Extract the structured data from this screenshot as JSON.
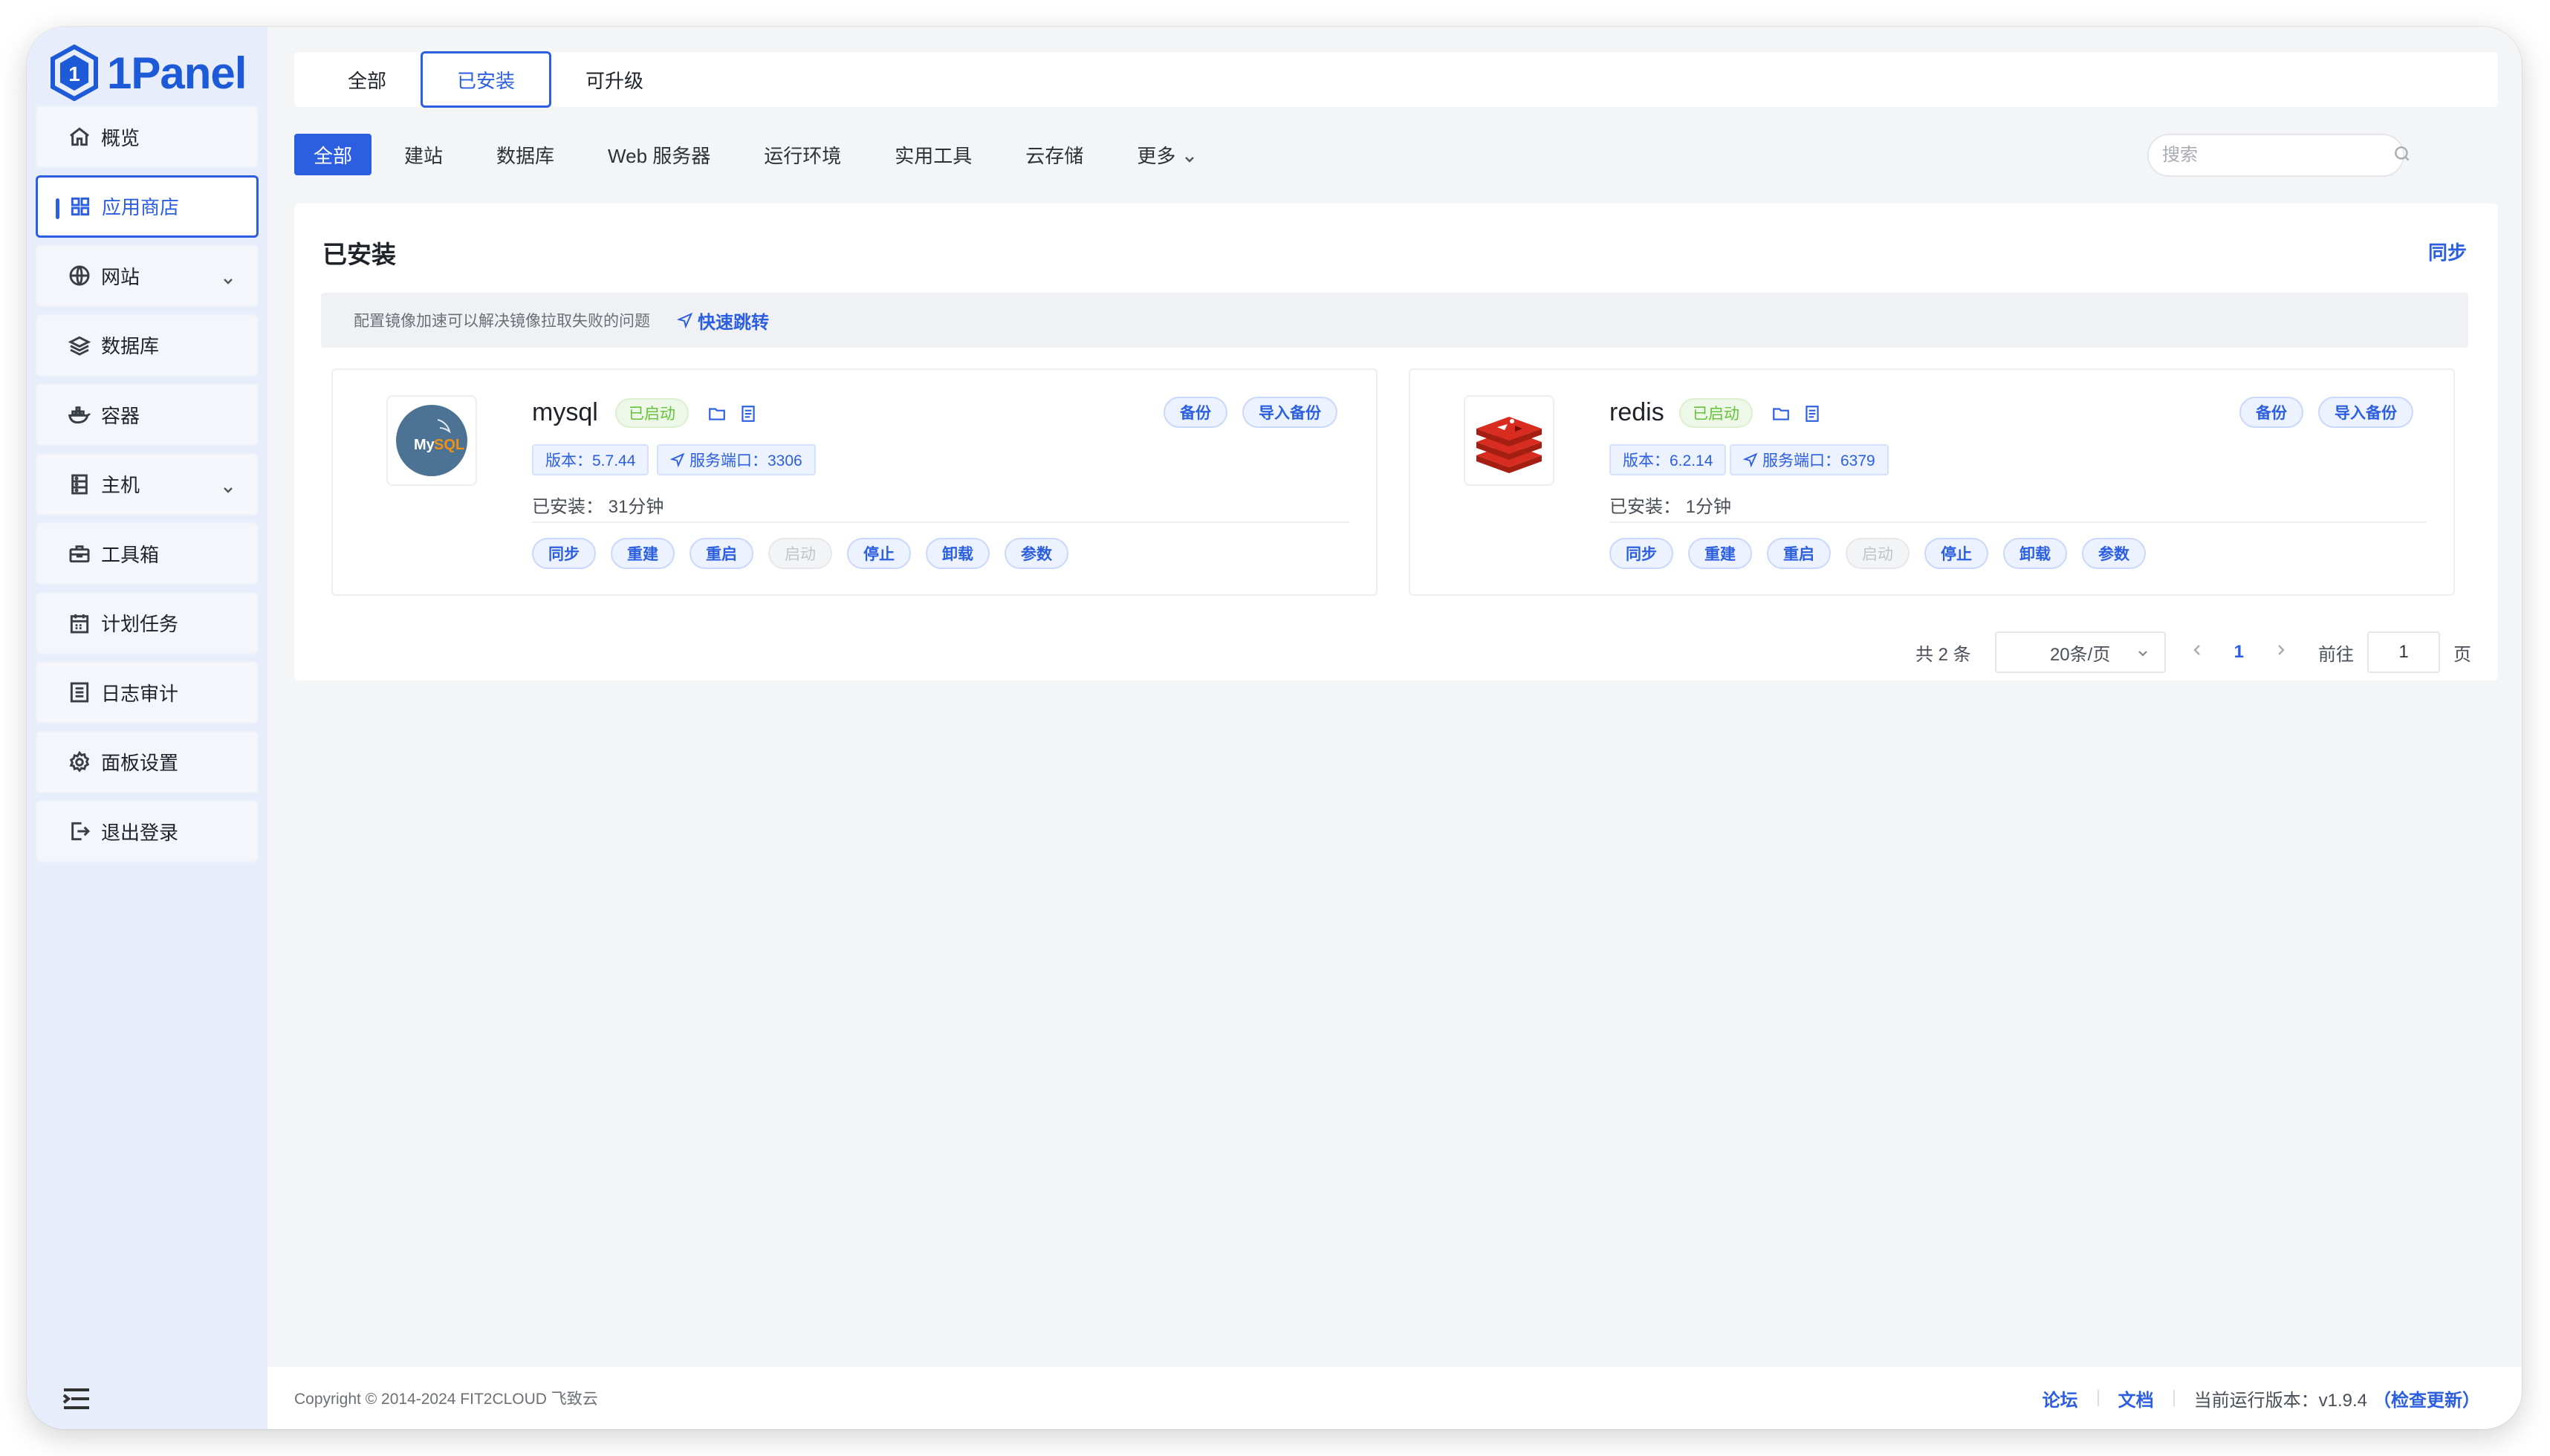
{
  "brand": {
    "name": "1Panel"
  },
  "sidebar": {
    "items": [
      {
        "label": "概览",
        "icon": "home-icon"
      },
      {
        "label": "应用商店",
        "icon": "grid-icon",
        "active": true
      },
      {
        "label": "网站",
        "icon": "globe-icon",
        "expandable": true
      },
      {
        "label": "数据库",
        "icon": "layers-icon"
      },
      {
        "label": "容器",
        "icon": "docker-whale-icon"
      },
      {
        "label": "主机",
        "icon": "server-icon",
        "expandable": true
      },
      {
        "label": "工具箱",
        "icon": "toolbox-icon"
      },
      {
        "label": "计划任务",
        "icon": "calendar-icon"
      },
      {
        "label": "日志审计",
        "icon": "log-icon"
      },
      {
        "label": "面板设置",
        "icon": "gear-icon"
      },
      {
        "label": "退出登录",
        "icon": "logout-icon"
      }
    ]
  },
  "tabs": [
    {
      "label": "全部"
    },
    {
      "label": "已安装",
      "active": true
    },
    {
      "label": "可升级"
    }
  ],
  "categories": [
    {
      "label": "全部",
      "active": true
    },
    {
      "label": "建站"
    },
    {
      "label": "数据库"
    },
    {
      "label": "Web 服务器"
    },
    {
      "label": "运行环境"
    },
    {
      "label": "实用工具"
    },
    {
      "label": "云存储"
    },
    {
      "label": "更多"
    }
  ],
  "search": {
    "placeholder": "搜索",
    "value": ""
  },
  "panel": {
    "title": "已安装",
    "sync_label": "同步",
    "notice": "配置镜像加速可以解决镜像拉取失败的问题",
    "notice_link": "快速跳转"
  },
  "apps": [
    {
      "name": "mysql",
      "status": "已启动",
      "version": "版本：5.7.44",
      "port": "服务端口：3306",
      "installed": "已安装：  31分钟",
      "backup_label": "备份",
      "import_label": "导入备份",
      "actions": [
        "同步",
        "重建",
        "重启",
        "启动",
        "停止",
        "卸载",
        "参数"
      ]
    },
    {
      "name": "redis",
      "status": "已启动",
      "version": "版本：6.2.14",
      "port": "服务端口：6379",
      "installed": "已安装：  1分钟",
      "backup_label": "备份",
      "import_label": "导入备份",
      "actions": [
        "同步",
        "重建",
        "重启",
        "启动",
        "停止",
        "卸载",
        "参数"
      ]
    }
  ],
  "pager": {
    "total": "共 2 条",
    "size": "20条/页",
    "current": "1",
    "goto": "前往",
    "goto_value": "1",
    "page_unit": "页"
  },
  "footer": {
    "copyright": "Copyright © 2014-2024 FIT2CLOUD 飞致云",
    "forum": "论坛",
    "docs": "文档",
    "version": "当前运行版本：v1.9.4",
    "check_update": "（检查更新）"
  },
  "colors": {
    "accent": "#2c5fe0",
    "sidebar_bg": "#e7edfb",
    "success": "#67c23a"
  }
}
